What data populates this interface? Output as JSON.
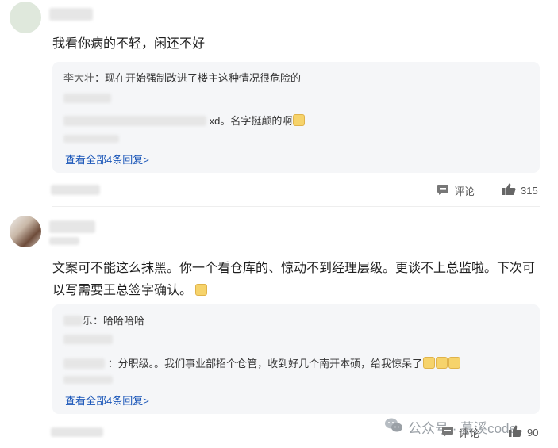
{
  "comment1": {
    "text": "我看你病的不轻，闲还不好",
    "replies": [
      {
        "author": "李大壮",
        "text": "：现在开始强制改进了楼主这种情况很危险的"
      },
      {
        "author": "",
        "text": "xd。名字挺颠的啊"
      }
    ],
    "view_all": "查看全部4条回复>",
    "comment_label": "评论",
    "like_count": "315"
  },
  "comment2": {
    "text_line1": "文案可不能这么抹黑。你一个看仓库的、惊动不到经理层级。更谈不上总监啦。下次可",
    "text_line2": "以写需要王总签字确认。",
    "replies": [
      {
        "author": "乐",
        "text": "：哈哈哈哈"
      },
      {
        "author": "",
        "text": "：分职级。。我们事业部招个仓管，收到好几个南开本硕，给我惊呆了"
      }
    ],
    "view_all": "查看全部4条回复>",
    "comment_label": "评论",
    "like_count": "90"
  },
  "watermark": {
    "text": "公众号 · 慕溪code"
  },
  "icons": {
    "comment": "comment-icon",
    "like": "thumbs-up-icon",
    "wechat": "wechat-icon"
  },
  "colors": {
    "link": "#1a56b8",
    "reply_bg": "#f5f6f8",
    "text": "#1f1f1f"
  }
}
